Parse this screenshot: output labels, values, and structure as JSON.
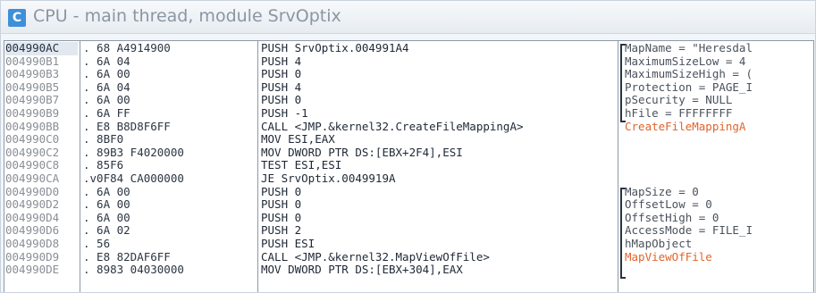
{
  "window": {
    "icon_letter": "C",
    "title": "CPU - main thread, module SrvOptix"
  },
  "rows": [
    {
      "addr": "004990AC",
      "hex": ". 68 A4914900",
      "asm": "PUSH SrvOptix.004991A4",
      "comment": "MapName = \"Heresdal",
      "selected": true
    },
    {
      "addr": "004990B1",
      "hex": ". 6A 04",
      "asm": "PUSH 4",
      "comment": "MaximumSizeLow = 4"
    },
    {
      "addr": "004990B3",
      "hex": ". 6A 00",
      "asm": "PUSH 0",
      "comment": "MaximumSizeHigh = ("
    },
    {
      "addr": "004990B5",
      "hex": ". 6A 04",
      "asm": "PUSH 4",
      "comment": "Protection = PAGE_I"
    },
    {
      "addr": "004990B7",
      "hex": ". 6A 00",
      "asm": "PUSH 0",
      "comment": "pSecurity = NULL"
    },
    {
      "addr": "004990B9",
      "hex": ". 6A FF",
      "asm": "PUSH -1",
      "comment": "hFile = FFFFFFFF"
    },
    {
      "addr": "004990BB",
      "hex": ". E8 B8D8F6FF",
      "asm": "CALL <JMP.&kernel32.CreateFileMappingA>",
      "comment": "CreateFileMappingA",
      "comment_red": true
    },
    {
      "addr": "004990C0",
      "hex": ". 8BF0",
      "asm": "MOV ESI,EAX",
      "comment": ""
    },
    {
      "addr": "004990C2",
      "hex": ". 89B3 F4020000",
      "asm": "MOV DWORD PTR DS:[EBX+2F4],ESI",
      "comment": ""
    },
    {
      "addr": "004990C8",
      "hex": ". 85F6",
      "asm": "TEST ESI,ESI",
      "comment": ""
    },
    {
      "addr": "004990CA",
      "hex": ".v0F84 CA000000",
      "asm": "JE SrvOptix.0049919A",
      "comment": ""
    },
    {
      "addr": "004990D0",
      "hex": ". 6A 00",
      "asm": "PUSH 0",
      "comment": "MapSize = 0"
    },
    {
      "addr": "004990D2",
      "hex": ". 6A 00",
      "asm": "PUSH 0",
      "comment": "OffsetLow = 0"
    },
    {
      "addr": "004990D4",
      "hex": ". 6A 00",
      "asm": "PUSH 0",
      "comment": "OffsetHigh = 0"
    },
    {
      "addr": "004990D6",
      "hex": ". 6A 02",
      "asm": "PUSH 2",
      "comment": "AccessMode = FILE_I"
    },
    {
      "addr": "004990D8",
      "hex": ". 56",
      "asm": "PUSH ESI",
      "comment": "hMapObject"
    },
    {
      "addr": "004990D9",
      "hex": ". E8 82DAF6FF",
      "asm": "CALL <JMP.&kernel32.MapViewOfFile>",
      "comment": "MapViewOfFile",
      "comment_red": true
    },
    {
      "addr": "004990DE",
      "hex": ". 8983 04030000",
      "asm": "MOV DWORD PTR DS:[EBX+304],EAX",
      "comment": ""
    }
  ],
  "colors": {
    "accent": "#3f8fd8",
    "api_comment": "#e0642c",
    "border": "#8d99a6"
  }
}
